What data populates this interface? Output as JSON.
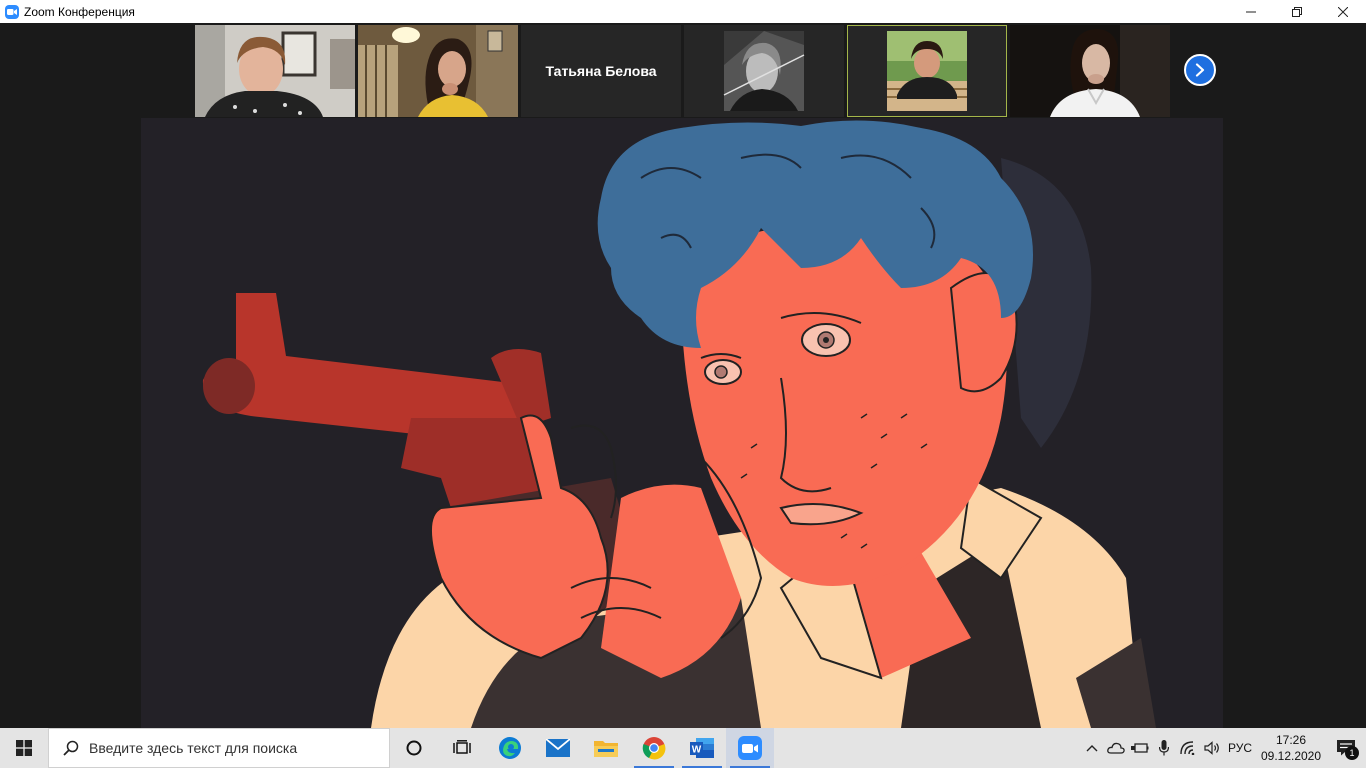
{
  "window": {
    "title": "Zoom Конференция",
    "minimize_icon": "minimize-icon",
    "restore_icon": "restore-icon",
    "close_icon": "close-icon"
  },
  "gallery": {
    "tiles": [
      {
        "type": "video",
        "subject": "participant-video-1"
      },
      {
        "type": "video",
        "subject": "participant-video-2"
      },
      {
        "type": "name",
        "name": "Татьяна Белова"
      },
      {
        "type": "video",
        "subject": "participant-video-4"
      },
      {
        "type": "video",
        "subject": "participant-video-5",
        "active_speaker": true
      },
      {
        "type": "video",
        "subject": "participant-video-6"
      }
    ],
    "next_page_icon": "chevron-right-icon"
  },
  "shared_screen": {
    "content": "illustration-man-aiming-gun"
  },
  "taskbar": {
    "search_placeholder": "Введите здесь текст для поиска",
    "apps": [
      {
        "name": "cortana",
        "icon": "circle-icon"
      },
      {
        "name": "task-view",
        "icon": "task-view-icon"
      },
      {
        "name": "edge",
        "icon": "edge-icon"
      },
      {
        "name": "mail",
        "icon": "mail-icon"
      },
      {
        "name": "file-explorer",
        "icon": "folder-icon"
      },
      {
        "name": "chrome",
        "icon": "chrome-icon",
        "running": true
      },
      {
        "name": "word",
        "icon": "word-icon",
        "running": true
      },
      {
        "name": "zoom",
        "icon": "zoom-icon",
        "running": true,
        "current": true
      }
    ],
    "tray": {
      "language": "РУС",
      "time": "17:26",
      "date": "09.12.2020",
      "notifications_count": "1"
    }
  },
  "colors": {
    "zoom_blue": "#2d8cff",
    "active_speaker_border": "#a4b64a",
    "share_background": "#232127",
    "hair_blue": "#3e6e9a",
    "skin_coral": "#f96b54",
    "gun_red": "#b8352b",
    "shirt_cream": "#fcd5a8"
  }
}
